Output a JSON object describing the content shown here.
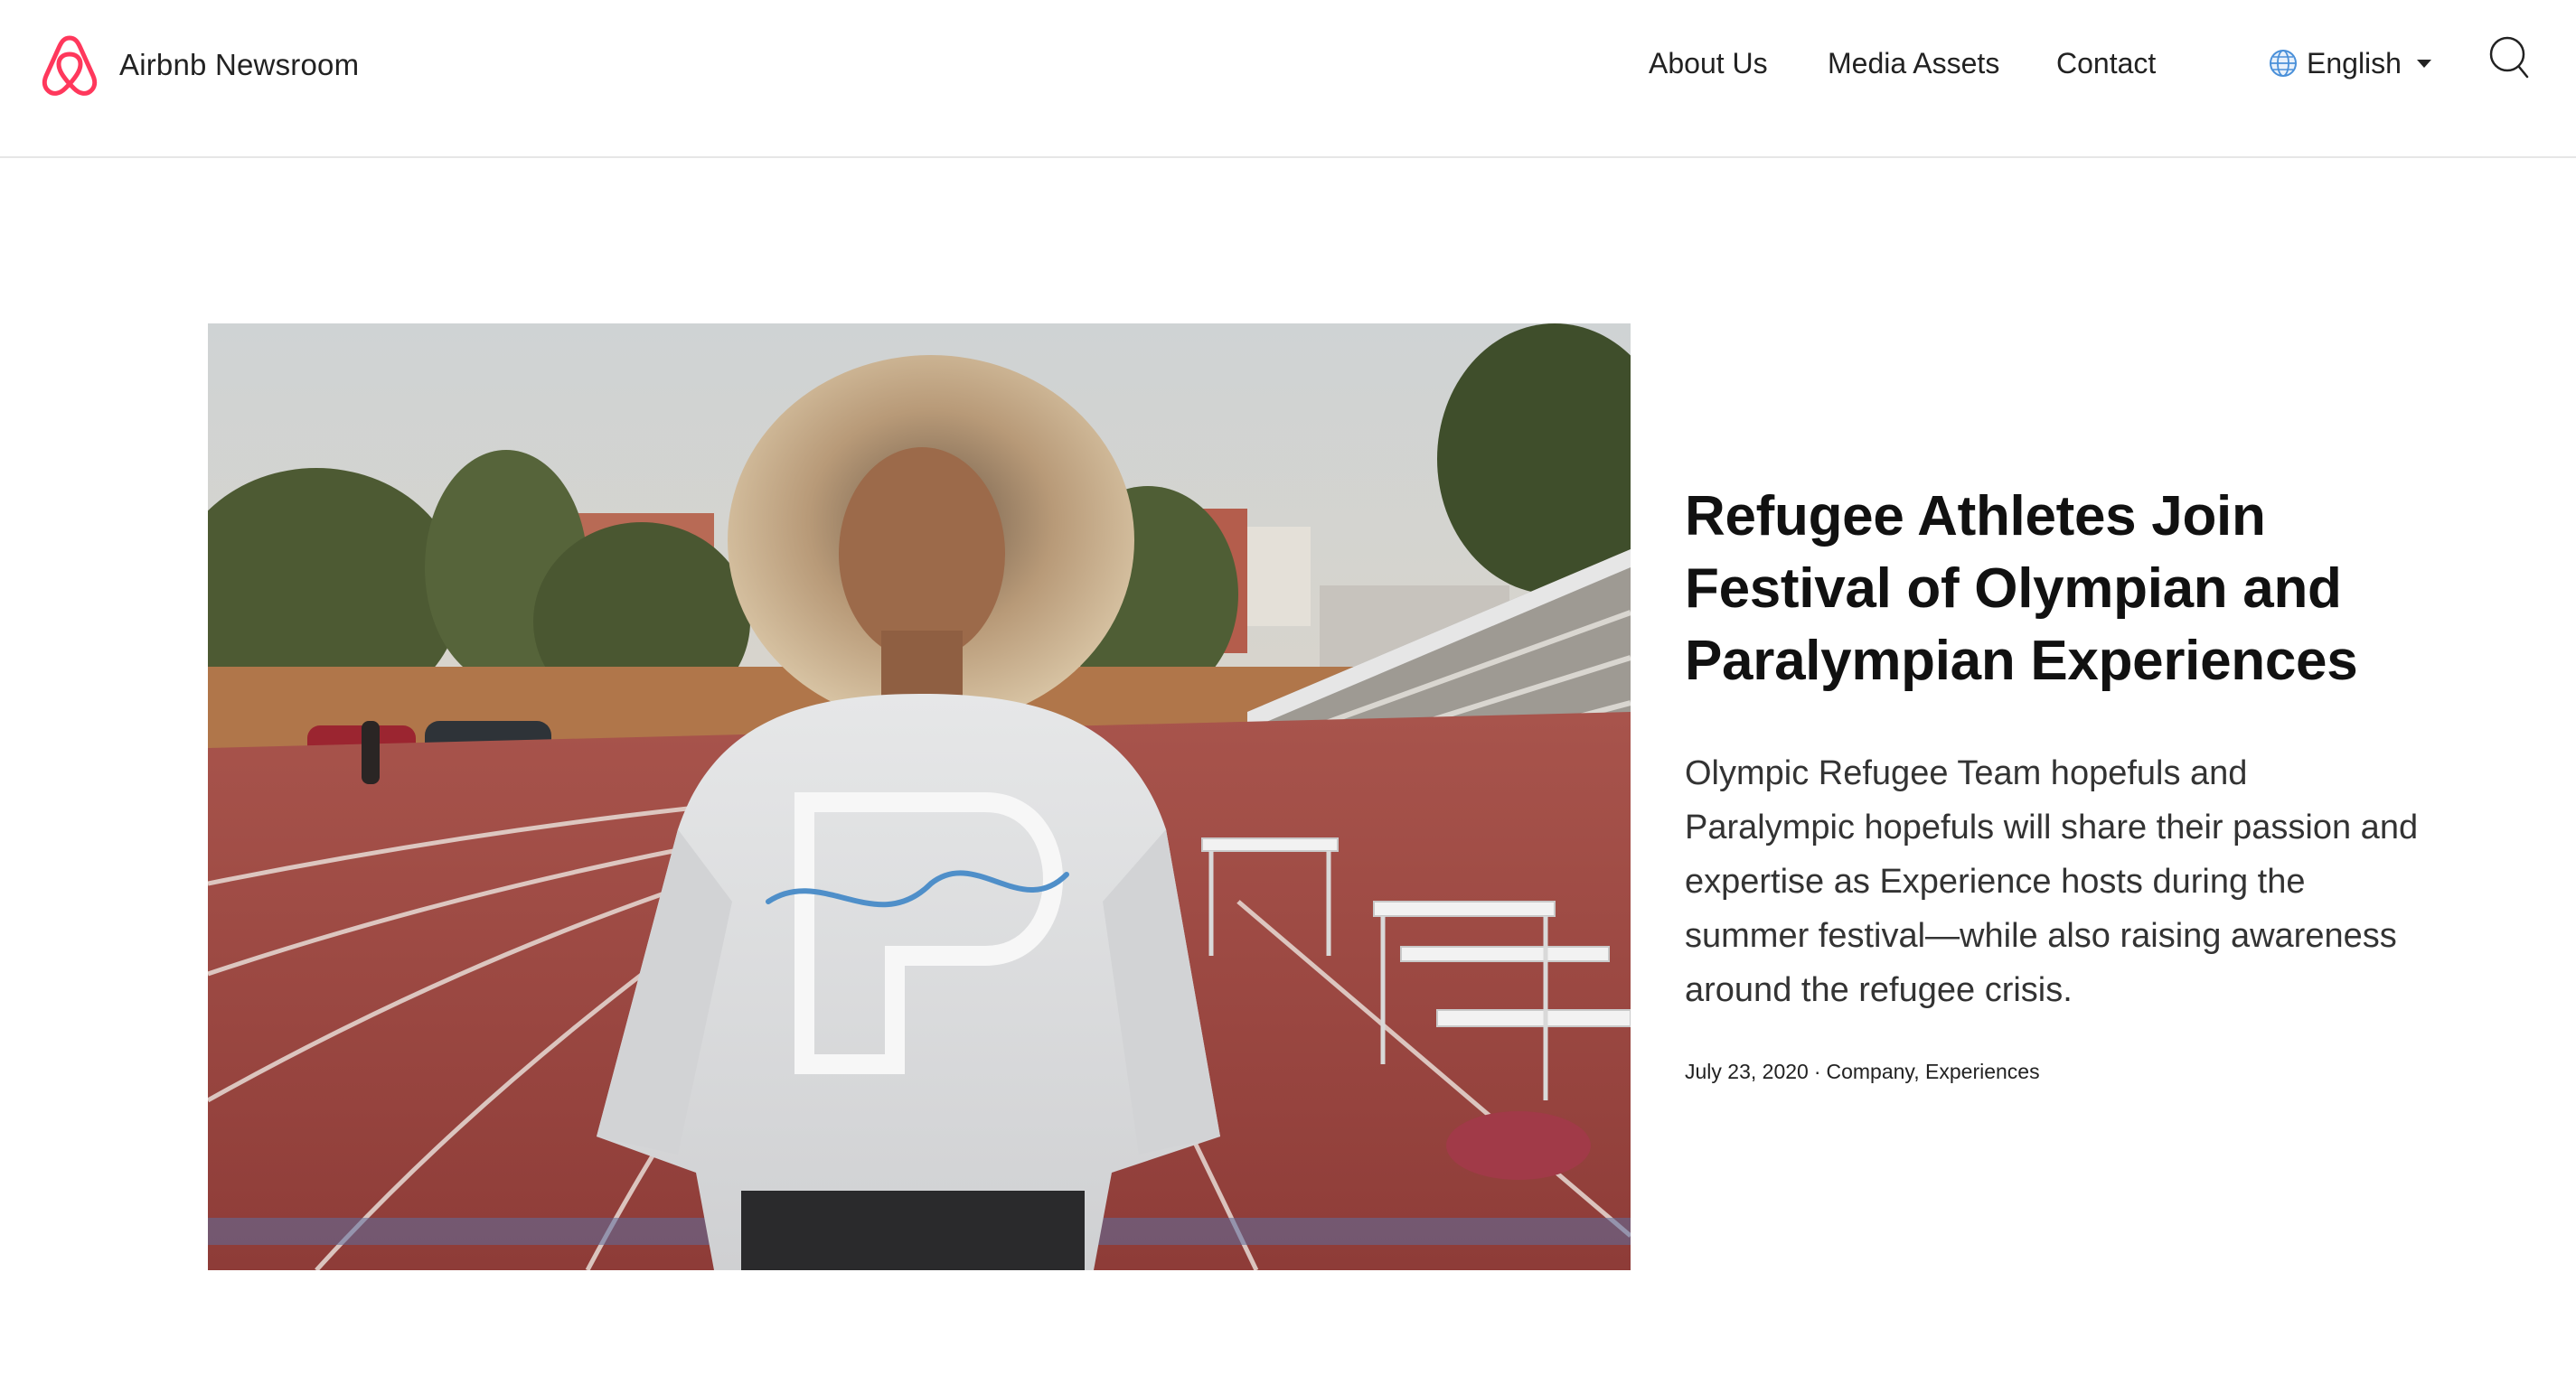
{
  "header": {
    "brand_name": "Airbnb Newsroom",
    "brand_color": "#FF385C",
    "logo_icon": "airbnb-belo-icon",
    "nav": [
      {
        "label": "About Us"
      },
      {
        "label": "Media Assets"
      },
      {
        "label": "Contact"
      }
    ],
    "language": {
      "icon": "globe-icon",
      "label": "English",
      "caret_icon": "caret-down-icon"
    },
    "search_icon": "search-icon"
  },
  "featured": {
    "image": {
      "icon": "photo-woman-on-running-track"
    },
    "title": "Refugee Athletes Join Festival of Olympian and Paralympian Experiences",
    "summary": "Olympic Refugee Team hopefuls and Paralympic hopefuls will share their passion and expertise as Experience hosts during the summer festival—while also raising awareness around the refugee crisis.",
    "date": "July 23, 2020",
    "separator": "·",
    "categories": [
      "Company",
      "Experiences"
    ],
    "category_separator": ", "
  }
}
